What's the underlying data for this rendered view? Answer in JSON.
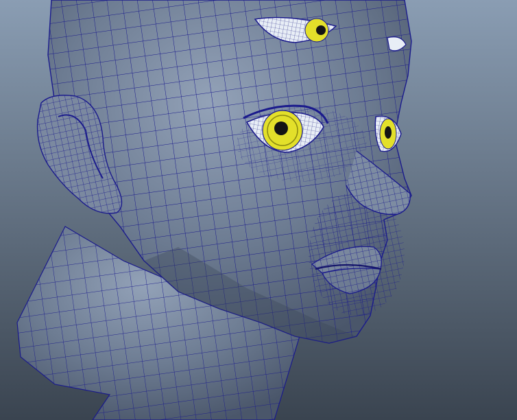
{
  "viewport": {
    "colors": {
      "background_top": "#8a9db3",
      "background_bottom": "#3a4450",
      "mesh_fill": "#6d7c92",
      "mesh_fill_shadow": "#4a566a",
      "mesh_fill_light": "#93a2b8",
      "wireframe": "#1a1a8c",
      "eye_sclera": "#e8eef6",
      "eye_iris": "#e3e02a",
      "eye_iris_dark": "#8c8a12",
      "pupil": "#141414"
    }
  }
}
